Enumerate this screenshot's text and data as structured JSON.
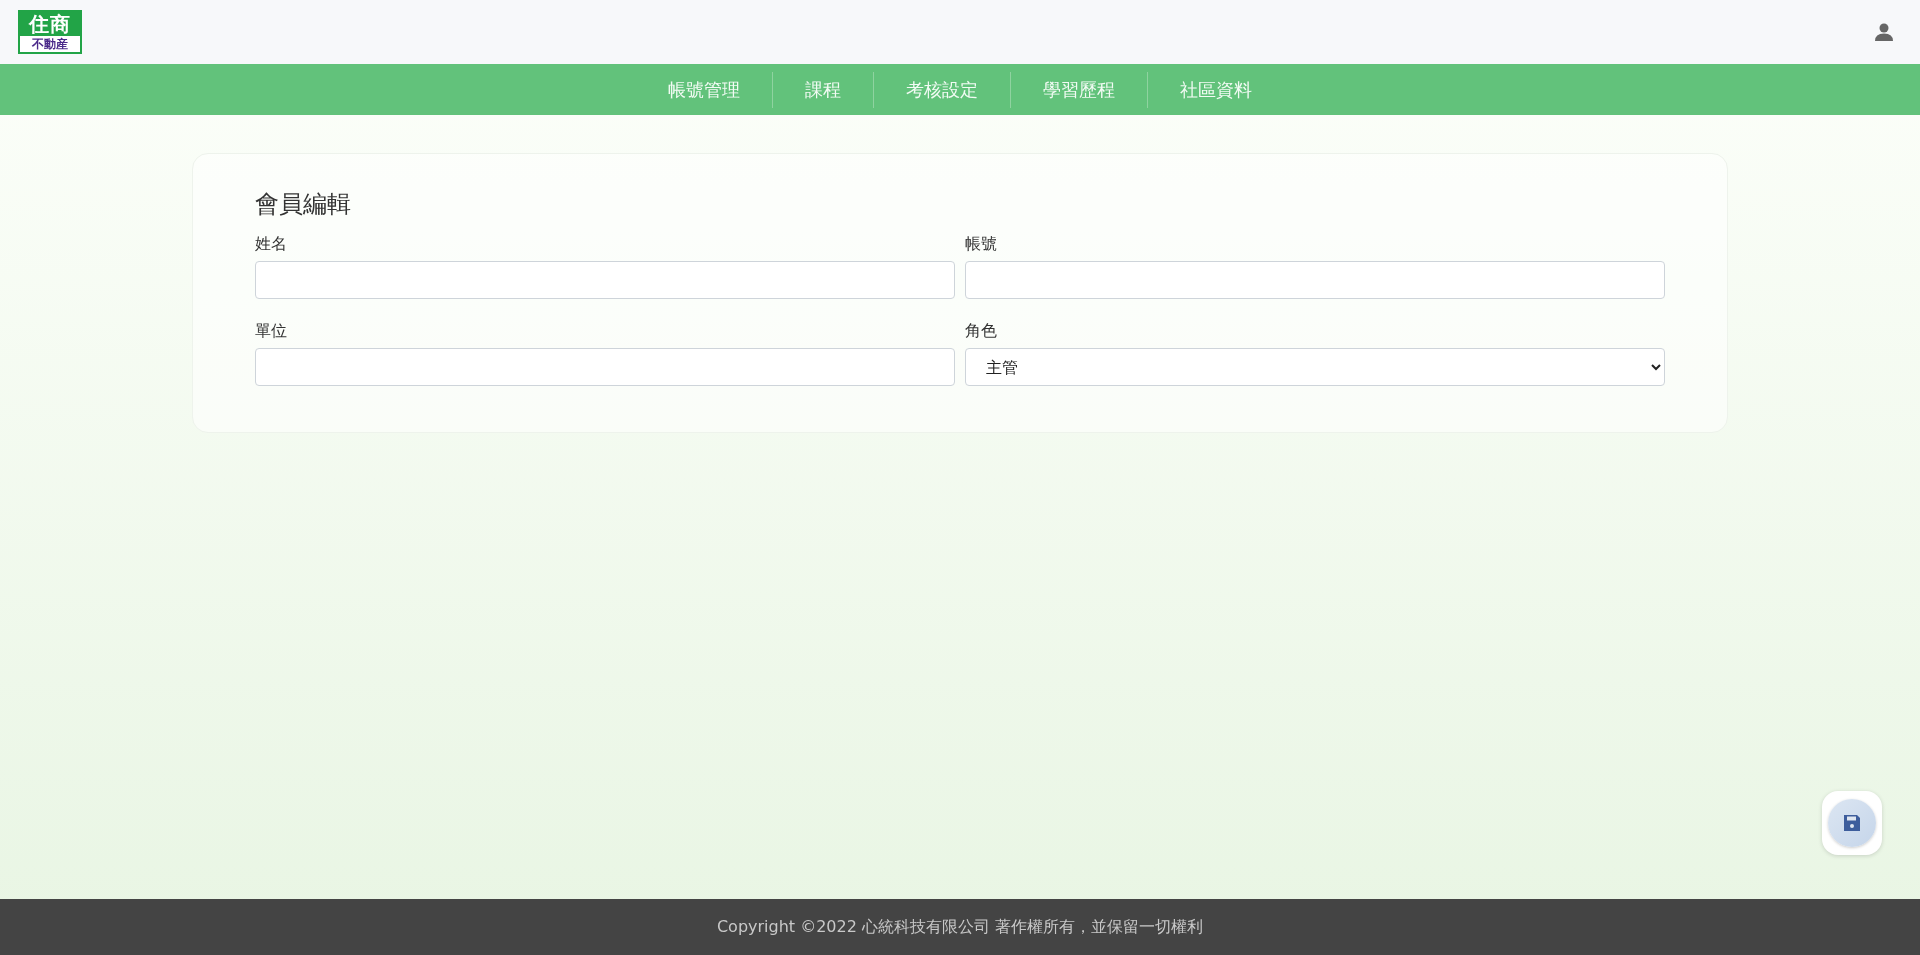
{
  "logo": {
    "top": "住商",
    "bottom": "不動産"
  },
  "nav": [
    "帳號管理",
    "課程",
    "考核設定",
    "學習歷程",
    "社區資料"
  ],
  "form": {
    "title": "會員編輯",
    "fields": [
      {
        "label": "姓名",
        "kind": "text"
      },
      {
        "label": "帳號",
        "kind": "text"
      },
      {
        "label": "單位",
        "kind": "text"
      },
      {
        "label": "角色",
        "kind": "select",
        "value": "主管"
      }
    ]
  },
  "footer": "Copyright ©2022 心統科技有限公司 著作權所有，並保留一切權利"
}
